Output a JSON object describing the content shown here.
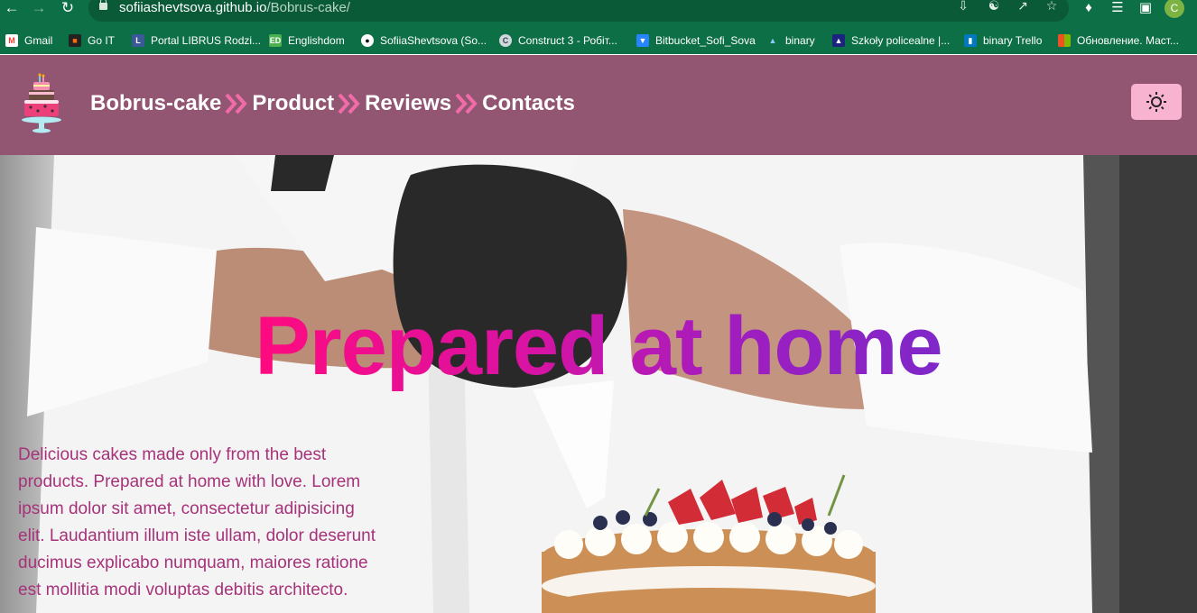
{
  "browser": {
    "url_host": "sofiiashevtsova.github.io",
    "url_path": "/Bobrus-cake/",
    "profile_initial": "C",
    "bookmarks": [
      {
        "label": "Gmail",
        "icon": "gmail-icon",
        "color": "#ea4335"
      },
      {
        "label": "Go IT",
        "icon": "goit-icon",
        "color": "#ff6b08"
      },
      {
        "label": "Portal LIBRUS Rodzi...",
        "icon": "librus-icon",
        "color": "#3b5998"
      },
      {
        "label": "Englishdom",
        "icon": "englishdom-icon",
        "color": "#4caf50"
      },
      {
        "label": "SofiiaShevtsova (So...",
        "icon": "github-icon",
        "color": "#ffffff"
      },
      {
        "label": "Construct 3 - Робіт...",
        "icon": "construct-icon",
        "color": "#e0e0e0"
      },
      {
        "label": "Bitbucket_Sofi_Sova",
        "icon": "bitbucket-icon",
        "color": "#2684ff"
      },
      {
        "label": "binary",
        "icon": "binary-icon",
        "color": "#ffffff"
      },
      {
        "label": "Szkoły policealne |...",
        "icon": "school-icon",
        "color": "#1a237e"
      },
      {
        "label": "binary Trello",
        "icon": "trello-icon",
        "color": "#0079bf"
      },
      {
        "label": "Обновление. Маст...",
        "icon": "microsoft-icon",
        "color": "#f25022"
      }
    ]
  },
  "site": {
    "nav": [
      "Bobrus-cake",
      "Product",
      "Reviews",
      "Contacts"
    ],
    "theme_toggle_icon": "sun-icon",
    "header_color": "#935672",
    "accent_color": "#f06ba8"
  },
  "hero": {
    "title": "Prepared at home",
    "text": "Delicious cakes made only from the best products. Prepared at home with love. Lorem ipsum dolor sit amet, consectetur adipisicing elit. Laudantium illum iste ullam, dolor deserunt ducimus explicabo numquam, maiores ratione est mollitia modi voluptas debitis architecto."
  }
}
